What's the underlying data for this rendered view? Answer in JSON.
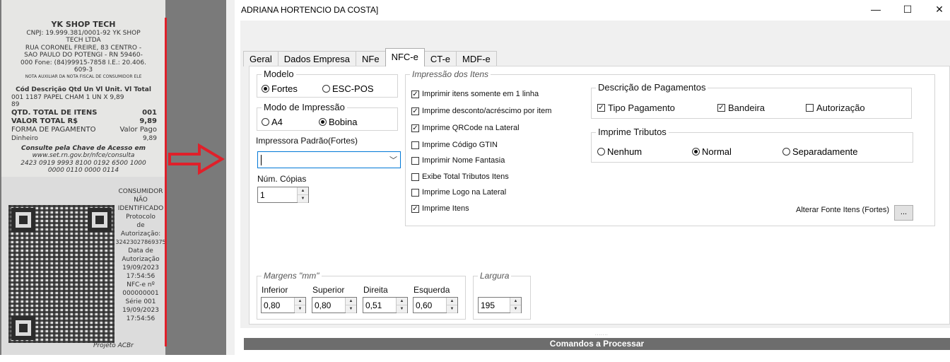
{
  "receipt": {
    "store_name": "YK SHOP TECH",
    "header_lines": [
      "CNPJ: 19.999.381/0001-92 YK SHOP",
      "TECH LTDA",
      "RUA CORONEL FREIRE, 83 CENTRO -",
      "SAO PAULO DO POTENGI - RN 59460-",
      "000 Fone: (84)99915-7858 I.E.: 20.406.",
      "609-3",
      "NOTA AUXILIAR DA NOTA FISCAL DE CONSUMIDOR ELE"
    ],
    "items_header": "Cód Descrição Qtd Un Vl Unit. Vl Total",
    "item_line": "001 1187 PAPEL CHAM 1 UN X 9,89",
    "item_total": "89",
    "qtd_label": "QTD. TOTAL DE ITENS",
    "qtd_value": "001",
    "valor_label": "VALOR TOTAL R$",
    "valor_value": "9,89",
    "forma_label": "FORMA DE PAGAMENTO",
    "forma_value": "Valor Pago",
    "dinheiro_label": "Dinheiro",
    "dinheiro_value": "9,89",
    "consulta_lines": [
      "Consulte pela Chave de Acesso em",
      "www.set.rn.gov.br/nfce/consulta"
    ],
    "chave_lines": [
      "2423 0919 9993 8100 0192 6500 1000",
      "0000 0110 0000 0114"
    ],
    "side_lines": [
      "CONSUMIDOR",
      "NÃO",
      "IDENTIFICADO",
      "Protocolo",
      "de",
      "Autorização:",
      "32423027869375",
      "Data de",
      "Autorização",
      "19/09/2023",
      "17:54:56",
      "NFC-e nº",
      "000000001",
      "Série 001",
      "19/09/2023",
      "17:54:56"
    ],
    "footer": "Projeto ACBr"
  },
  "window": {
    "title": "ADRIANA HORTENCIO DA COSTA]",
    "minimize": "—",
    "maximize": "☐",
    "close": "✕"
  },
  "tabs": [
    {
      "label": "Geral"
    },
    {
      "label": "Dados Empresa"
    },
    {
      "label": "NFe"
    },
    {
      "label": "NFC-e",
      "active": true
    },
    {
      "label": "CT-e"
    },
    {
      "label": "MDF-e"
    }
  ],
  "modelo": {
    "title": "Modelo",
    "options": [
      {
        "label": "Fortes",
        "selected": true
      },
      {
        "label": "ESC-POS",
        "selected": false
      }
    ]
  },
  "modo_impressao": {
    "title": "Modo de Impressão",
    "options": [
      {
        "label": "A4",
        "selected": false
      },
      {
        "label": "Bobina",
        "selected": true
      }
    ]
  },
  "impressora": {
    "label": "Impressora Padrão(Fortes)",
    "value": ""
  },
  "copias": {
    "label": "Núm. Cópias",
    "value": "1"
  },
  "impressao_itens": {
    "title": "Impressão dos Itens",
    "checkboxes": [
      {
        "label": "Imprimir itens somente em 1 linha",
        "checked": true
      },
      {
        "label": "Imprime desconto/acréscimo por item",
        "checked": true
      },
      {
        "label": "Imprime QRCode na Lateral",
        "checked": true
      },
      {
        "label": "Imprime Código GTIN",
        "checked": false
      },
      {
        "label": "Imprimir Nome Fantasia",
        "checked": false
      },
      {
        "label": "Exibe Total Tributos Itens",
        "checked": false
      },
      {
        "label": "Imprime Logo na Lateral",
        "checked": false
      },
      {
        "label": "Imprime Itens",
        "checked": true
      }
    ],
    "fonte_label": "Alterar Fonte Itens (Fortes)",
    "fonte_button": "..."
  },
  "descricao_pagamentos": {
    "title": "Descrição de Pagamentos",
    "checkboxes": [
      {
        "label": "Tipo Pagamento",
        "checked": true
      },
      {
        "label": "Bandeira",
        "checked": true
      },
      {
        "label": "Autorização",
        "checked": false
      }
    ]
  },
  "imprime_tributos": {
    "title": "Imprime Tributos",
    "options": [
      {
        "label": "Nenhum",
        "selected": false
      },
      {
        "label": "Normal",
        "selected": true
      },
      {
        "label": "Separadamente",
        "selected": false
      }
    ]
  },
  "margens": {
    "title": "Margens \"mm\"",
    "fields": [
      {
        "label": "Inferior",
        "value": "0,80"
      },
      {
        "label": "Superior",
        "value": "0,80"
      },
      {
        "label": "Direita",
        "value": "0,51"
      },
      {
        "label": "Esquerda",
        "value": "0,60"
      }
    ]
  },
  "largura": {
    "title": "Largura",
    "value": "195"
  },
  "commands_bar": "Comandos a Processar",
  "colors": {
    "accent": "#0078d7",
    "arrow": "#e0202a",
    "bar": "#6d6d6d"
  },
  "icons": {
    "checkbox_mark": "✓",
    "spin_up": "▲",
    "spin_down": "▼",
    "combo_arrow": "﹀"
  }
}
